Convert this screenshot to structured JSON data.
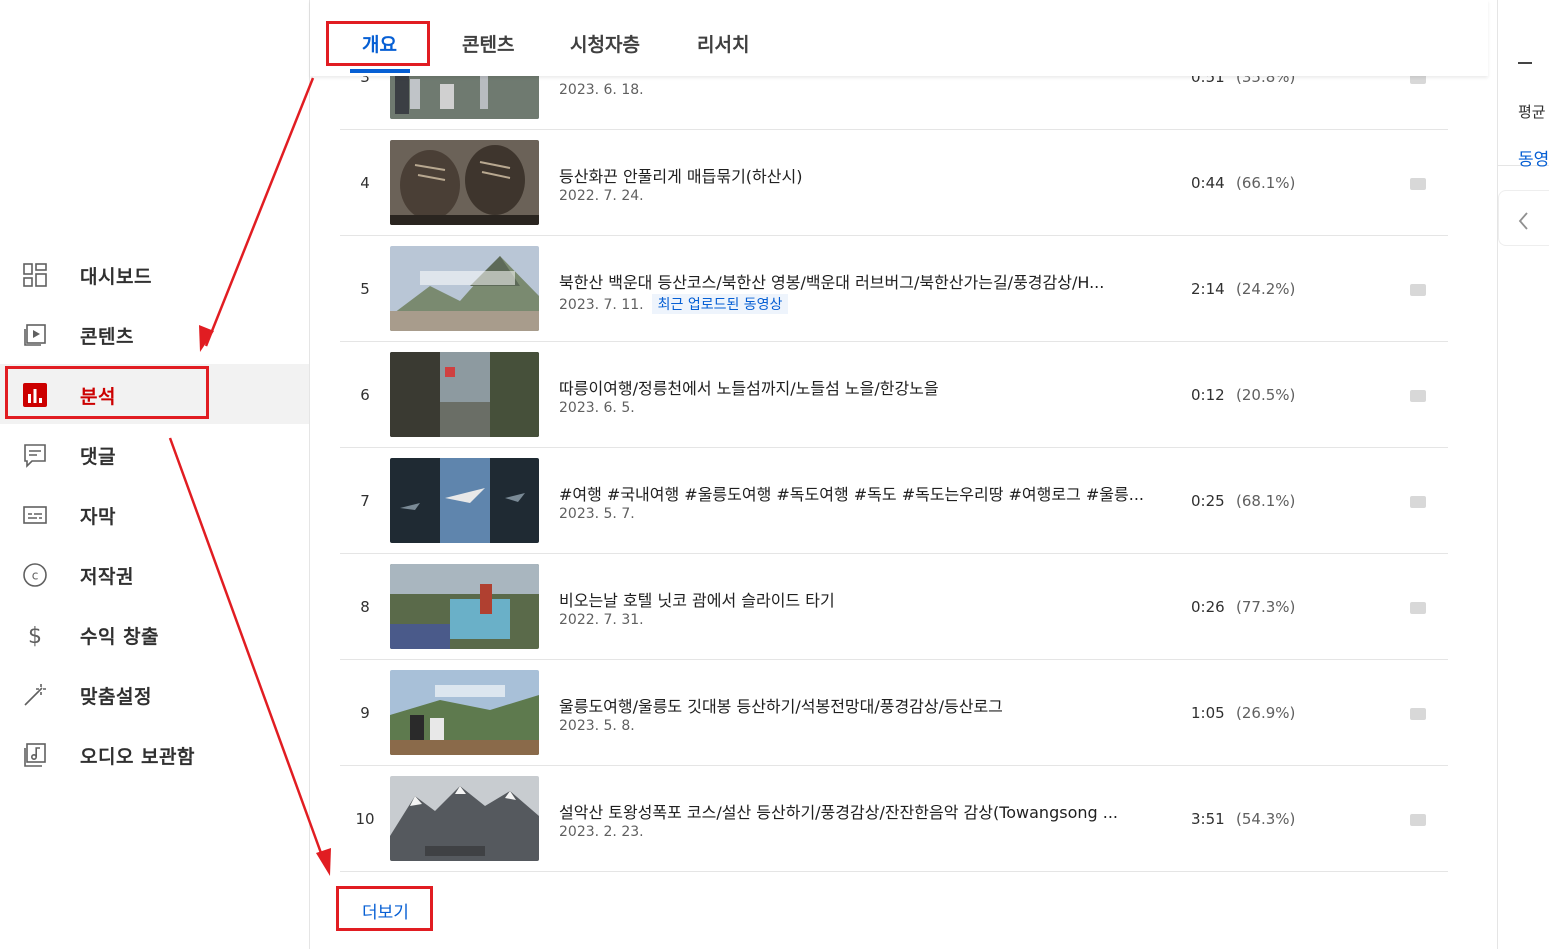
{
  "sidebar": {
    "items": [
      {
        "label": "대시보드",
        "icon": "dashboard-icon"
      },
      {
        "label": "콘텐츠",
        "icon": "content-icon"
      },
      {
        "label": "분석",
        "icon": "analytics-icon"
      },
      {
        "label": "댓글",
        "icon": "comments-icon"
      },
      {
        "label": "자막",
        "icon": "subtitles-icon"
      },
      {
        "label": "저작권",
        "icon": "copyright-icon"
      },
      {
        "label": "수익 창출",
        "icon": "monetization-icon"
      },
      {
        "label": "맞춤설정",
        "icon": "customization-icon"
      },
      {
        "label": "오디오 보관함",
        "icon": "audio-library-icon"
      }
    ],
    "active_label": "분석"
  },
  "tabs": [
    {
      "label": "개요",
      "active": true
    },
    {
      "label": "콘텐츠",
      "active": false
    },
    {
      "label": "시청자층",
      "active": false
    },
    {
      "label": "리서치",
      "active": false
    }
  ],
  "right_panel": {
    "text1": "평균",
    "text2": "동영"
  },
  "videos": [
    {
      "rank": "3",
      "title": "",
      "date": "2023. 6. 18.",
      "duration": "0:51",
      "percent": "(35.8%)"
    },
    {
      "rank": "4",
      "title": "등산화끈 안풀리게 매듭묶기(하산시)",
      "date": "2022. 7. 24.",
      "duration": "0:44",
      "percent": "(66.1%)"
    },
    {
      "rank": "5",
      "title": "북한산 백운대 등산코스/북한산 영봉/백운대 러브버그/북한산가는길/풍경감상/H...",
      "date": "2023. 7. 11.",
      "badge": "최근 업로드된 동영상",
      "duration": "2:14",
      "percent": "(24.2%)"
    },
    {
      "rank": "6",
      "title": "따릉이여행/정릉천에서 노들섬까지/노들섬 노을/한강노을",
      "date": "2023. 6. 5.",
      "duration": "0:12",
      "percent": "(20.5%)"
    },
    {
      "rank": "7",
      "title": "#여행 #국내여행 #울릉도여행 #독도여행 #독도 #독도는우리땅 #여행로그 #울릉...",
      "date": "2023. 5. 7.",
      "duration": "0:25",
      "percent": "(68.1%)"
    },
    {
      "rank": "8",
      "title": "비오는날 호텔 닛코 괌에서 슬라이드 타기",
      "date": "2022. 7. 31.",
      "duration": "0:26",
      "percent": "(77.3%)"
    },
    {
      "rank": "9",
      "title": "울릉도여행/울릉도 깃대봉 등산하기/석봉전망대/풍경감상/등산로그",
      "date": "2023. 5. 8.",
      "duration": "1:05",
      "percent": "(26.9%)"
    },
    {
      "rank": "10",
      "title": "설악산 토왕성폭포 코스/설산 등산하기/풍경감상/잔잔한음악 감상(Towangsong ...",
      "date": "2023. 2. 23.",
      "duration": "3:51",
      "percent": "(54.3%)"
    }
  ],
  "more_label": "더보기",
  "colors": {
    "accent": "#065fd4",
    "active_nav": "#cc0000",
    "annotation": "#e11d22"
  }
}
